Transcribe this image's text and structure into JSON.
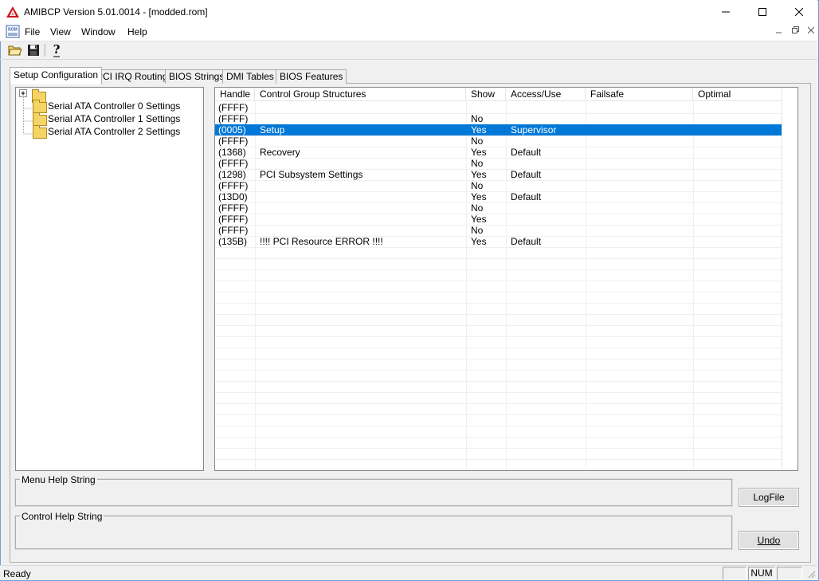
{
  "window": {
    "title": "AMIBCP Version 5.01.0014 - [modded.rom]"
  },
  "menu": [
    "File",
    "View",
    "Window",
    "Help"
  ],
  "tabs": [
    "Setup Configuration",
    "PCI IRQ Routing",
    "BIOS Strings",
    "DMI Tables",
    "BIOS Features"
  ],
  "tree": {
    "items": [
      "Serial ATA Controller 0 Settings",
      "Serial ATA Controller 1 Settings",
      "Serial ATA Controller 2 Settings"
    ]
  },
  "table": {
    "columns": [
      "Handle",
      "Control Group Structures",
      "Show",
      "Access/Use",
      "Failsafe",
      "Optimal"
    ],
    "rows": [
      [
        "(FFFF)",
        "",
        "",
        "",
        "",
        ""
      ],
      [
        "(FFFF)",
        "",
        "No",
        "",
        "",
        ""
      ],
      [
        "(0005)",
        "Setup",
        "Yes",
        "Supervisor",
        "",
        ""
      ],
      [
        "(FFFF)",
        "",
        "No",
        "",
        "",
        ""
      ],
      [
        "(1368)",
        "Recovery",
        "Yes",
        "Default",
        "",
        ""
      ],
      [
        "(FFFF)",
        "",
        "No",
        "",
        "",
        ""
      ],
      [
        "(1298)",
        "PCI Subsystem Settings",
        "Yes",
        "Default",
        "",
        ""
      ],
      [
        "(FFFF)",
        "",
        "No",
        "",
        "",
        ""
      ],
      [
        "(13D0)",
        "",
        "Yes",
        "Default",
        "",
        ""
      ],
      [
        "(FFFF)",
        "",
        "No",
        "",
        "",
        ""
      ],
      [
        "(FFFF)",
        "",
        "Yes",
        "",
        "",
        ""
      ],
      [
        "(FFFF)",
        "",
        "No",
        "",
        "",
        ""
      ],
      [
        "(135B)",
        "!!!! PCI Resource ERROR !!!!",
        "Yes",
        "Default",
        "",
        ""
      ]
    ],
    "selected_row": 2
  },
  "groups": {
    "menu_help": "Menu Help String",
    "control_help": "Control Help String"
  },
  "buttons": {
    "logfile": "LogFile",
    "undo": "Undo"
  },
  "status": {
    "text": "Ready",
    "num": "NUM"
  },
  "colors": {
    "selection": "#0078d7",
    "window_border": "#6e9fd6"
  },
  "icons": {
    "app": "amibcp-app-icon",
    "open": "open-folder-icon",
    "save": "floppy-disk-icon",
    "help": "help-question-icon"
  }
}
